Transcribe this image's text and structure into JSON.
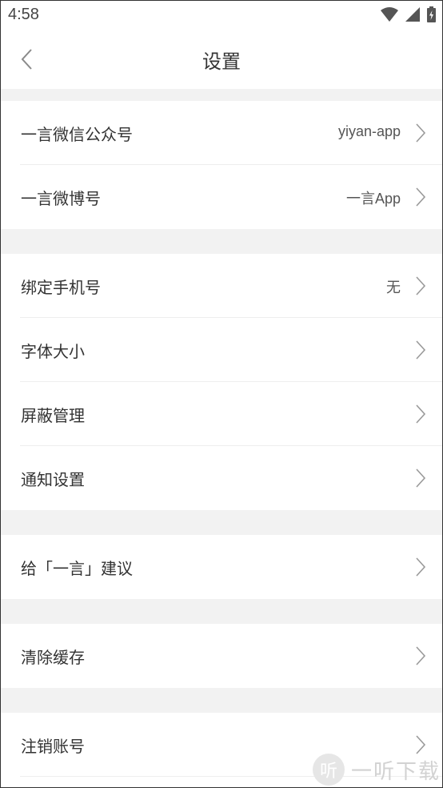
{
  "status_bar": {
    "time": "4:58",
    "icons": [
      "wifi-icon",
      "cell-signal-icon",
      "battery-charging-icon"
    ]
  },
  "nav": {
    "title": "设置",
    "back_icon": "chevron-left-icon"
  },
  "groups": [
    {
      "items": [
        {
          "label": "一言微信公众号",
          "value": "yiyan-app"
        },
        {
          "label": "一言微博号",
          "value": "一言App"
        }
      ]
    },
    {
      "items": [
        {
          "label": "绑定手机号",
          "value": "无"
        },
        {
          "label": "字体大小",
          "value": ""
        },
        {
          "label": "屏蔽管理",
          "value": ""
        },
        {
          "label": "通知设置",
          "value": ""
        }
      ]
    },
    {
      "items": [
        {
          "label": "给「一言」建议",
          "value": ""
        }
      ]
    },
    {
      "items": [
        {
          "label": "清除缓存",
          "value": ""
        }
      ]
    },
    {
      "items": [
        {
          "label": "注销账号",
          "value": ""
        }
      ]
    }
  ],
  "watermark": {
    "logo_text": "听",
    "text": "一听下载"
  },
  "colors": {
    "background": "#ffffff",
    "section_gap": "#f2f2f2",
    "divider": "#eeeeee",
    "text_primary": "#333333",
    "chevron": "#9a9a9a"
  }
}
